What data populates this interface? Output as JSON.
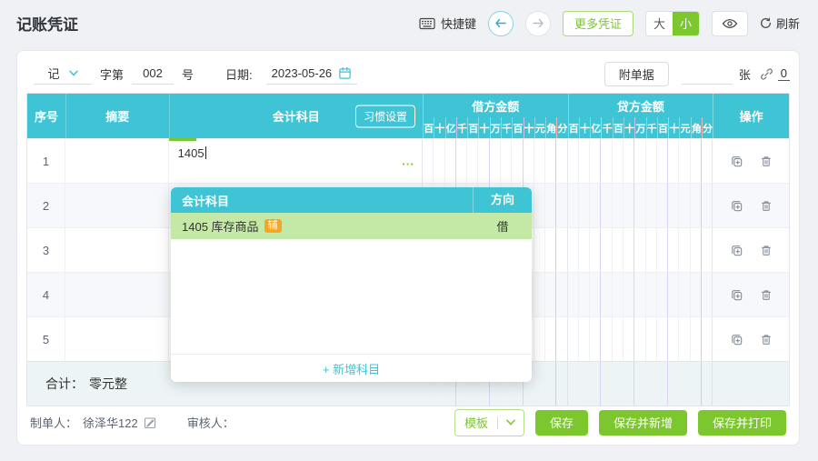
{
  "page": {
    "title": "记账凭证"
  },
  "toolbar": {
    "shortcut_label": "快捷键",
    "more_vouchers_label": "更多凭证",
    "size_large": "大",
    "size_small": "小",
    "refresh_label": "刷新"
  },
  "voucher_bar": {
    "word_value": "记",
    "zidi_label": "字第",
    "number_value": "002",
    "hao_label": "号",
    "date_label": "日期:",
    "date_value": "2023-05-26",
    "attachment_button_label": "附单据",
    "unit_label": "张",
    "attachment_count": "0"
  },
  "table": {
    "col_seq": "序号",
    "col_summary": "摘要",
    "col_subject": "会计科目",
    "habit_setting_button": "习惯设置",
    "col_debit": "借方金额",
    "col_credit": "贷方金额",
    "col_actions": "操作",
    "digit_labels": [
      "百",
      "十",
      "亿",
      "千",
      "百",
      "十",
      "万",
      "千",
      "百",
      "十",
      "元",
      "角",
      "分"
    ],
    "rows": [
      {
        "seq": "1",
        "subject_value": "1405",
        "ellipsis": "..."
      },
      {
        "seq": "2"
      },
      {
        "seq": "3"
      },
      {
        "seq": "4"
      },
      {
        "seq": "5"
      }
    ],
    "total_label": "合计：",
    "total_value": "零元整"
  },
  "dropdown": {
    "col_subject": "会计科目",
    "col_direction": "方向",
    "items": [
      {
        "label": "1405 库存商品",
        "badge": "辅",
        "direction": "借"
      }
    ],
    "add_button_label": "+ 新增科目"
  },
  "footer": {
    "maker_label": "制单人：",
    "maker_name": "徐泽华122",
    "reviewer_label": "审核人：",
    "template_button": "模板",
    "save_button": "保存",
    "save_new_button": "保存并新增",
    "save_print_button": "保存并打印"
  },
  "colors": {
    "header_teal": "#3ec4d5",
    "primary_green": "#7cc62e",
    "selected_row_green": "#c4e8a6",
    "badge_orange": "#f6a623",
    "grid_purple": "#dcd2f2",
    "grid_red": "#f6c0bc",
    "alt_row": "#f6f8fb",
    "total_row": "#ecf4f6"
  }
}
